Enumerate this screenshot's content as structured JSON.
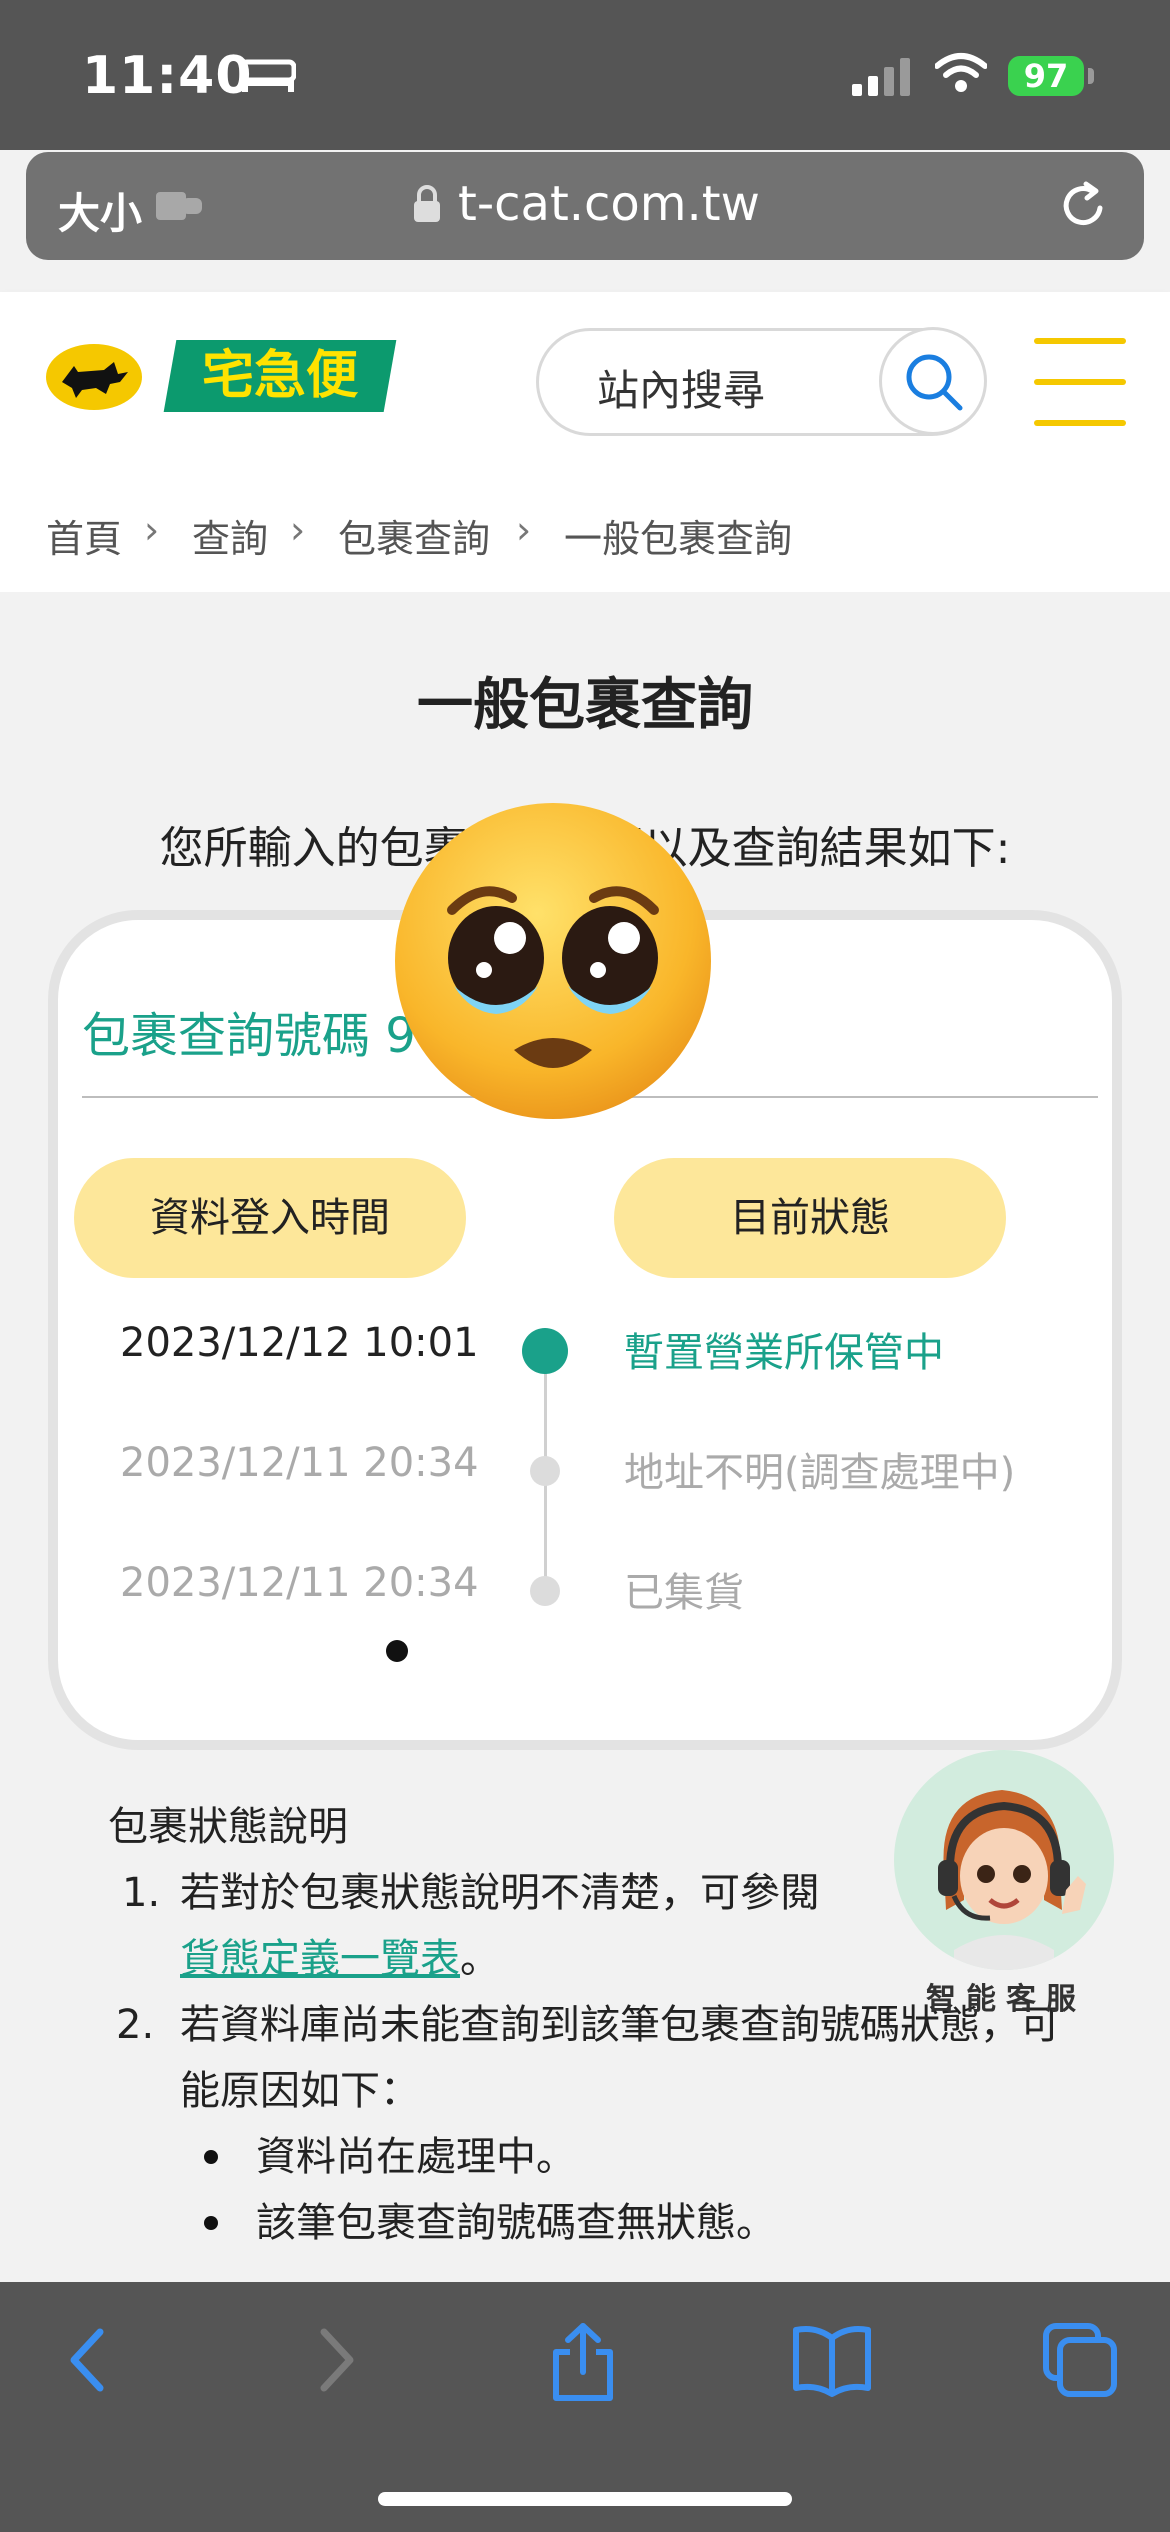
{
  "status_bar": {
    "time": "11:40",
    "battery": "97"
  },
  "browser": {
    "text_size_label": "大小",
    "url": "t-cat.com.tw"
  },
  "header": {
    "logo_text": "宅急便",
    "search_placeholder": "站內搜尋"
  },
  "breadcrumb": [
    "首頁",
    "查詢",
    "包裹查詢",
    "一般包裹查詢"
  ],
  "main": {
    "title": "一般包裹查詢",
    "intro": "您所輸入的包裹查詢號碼以及查詢結果如下:",
    "tracking_label": "包裹查詢號碼 9",
    "col_time": "資料登入時間",
    "col_status": "目前狀態",
    "rows": [
      {
        "time": "2023/12/12 10:01",
        "status": "暫置營業所保管中"
      },
      {
        "time": "2023/12/11 20:34",
        "status": "地址不明(調查處理中)"
      },
      {
        "time": "2023/12/11 20:34",
        "status": "已集貨"
      }
    ]
  },
  "notes": {
    "title": "包裹狀態說明",
    "item1_num": "1.",
    "item1_text": "若對於包裹狀態說明不清楚，可參閱",
    "item1_link": "貨態定義一覽表",
    "item1_end": "。",
    "item2_num": "2.",
    "item2_line1": "若資料庫尚未能查詢到該筆包裹查詢號碼狀態，可",
    "item2_line2": "能原因如下：",
    "bullet1": "資料尚在處理中。",
    "bullet2": "該筆包裹查詢號碼查無狀態。"
  },
  "assistant": {
    "label": "智能客服"
  },
  "colors": {
    "accent": "#1aa18a",
    "pill": "#fde79a",
    "brand_yellow": "#f5c800",
    "brand_green": "#0c9a6e"
  },
  "icons": [
    "bed-icon",
    "signal-icon",
    "wifi-icon",
    "extension-icon",
    "lock-icon",
    "reload-icon",
    "search-icon",
    "menu-icon",
    "chevron-right-icon",
    "back-icon",
    "forward-icon",
    "share-icon",
    "bookmarks-icon",
    "tabs-icon"
  ]
}
